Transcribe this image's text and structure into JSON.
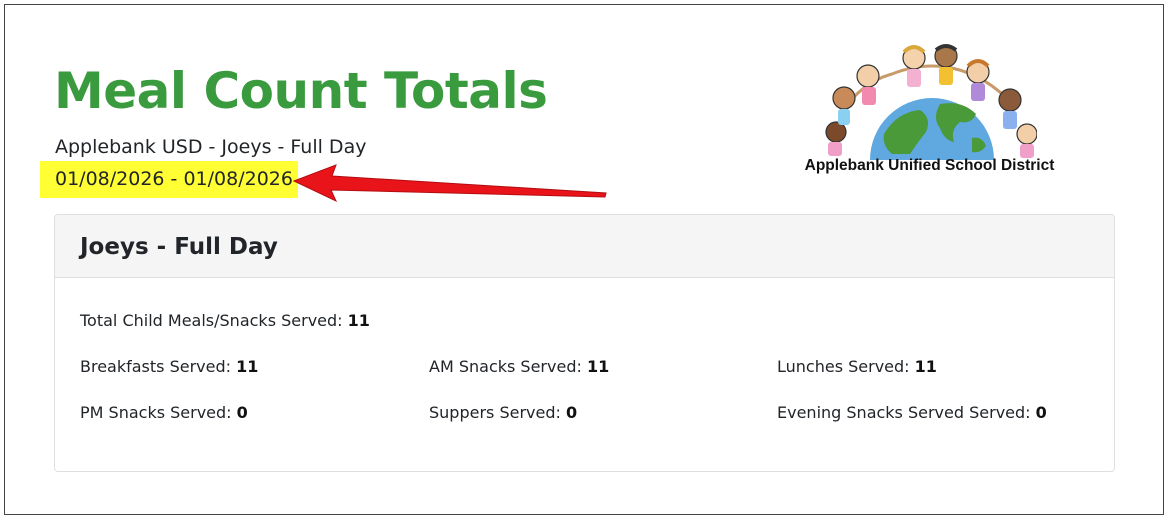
{
  "header": {
    "title": "Meal Count Totals",
    "subtitle": "Applebank USD - Joeys - Full Day",
    "date_range": "01/08/2026 - 01/08/2026"
  },
  "logo": {
    "text": "Applebank Unified School District"
  },
  "card": {
    "title": "Joeys - Full Day",
    "total": {
      "label": "Total Child Meals/Snacks Served:",
      "value": "11"
    },
    "stats": [
      {
        "label": "Breakfasts Served:",
        "value": "11"
      },
      {
        "label": "AM Snacks Served:",
        "value": "11"
      },
      {
        "label": "Lunches Served:",
        "value": "11"
      },
      {
        "label": "PM Snacks Served:",
        "value": "0"
      },
      {
        "label": "Suppers Served:",
        "value": "0"
      },
      {
        "label": "Evening Snacks Served Served:",
        "value": "0"
      }
    ]
  },
  "colors": {
    "title_green": "#3a9a3e",
    "highlight_yellow": "#ffff33",
    "arrow_red": "#e8141a"
  }
}
